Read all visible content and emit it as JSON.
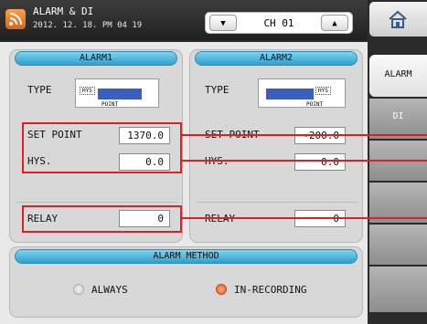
{
  "header": {
    "title": "ALARM & DI",
    "datetime": "2012. 12. 18. PM 04 19",
    "channel": "CH 01",
    "down_arrow": "▼",
    "up_arrow": "▲"
  },
  "nav": {
    "tabs": [
      {
        "label": "ALARM"
      },
      {
        "label": "DI"
      }
    ]
  },
  "alarm1": {
    "title": "ALARM1",
    "type_label": "TYPE",
    "type_icon_text": [
      "HYS",
      "POINT"
    ],
    "set_point_label": "SET POINT",
    "set_point": "1370.0",
    "hys_label": "HYS.",
    "hys": "0.0",
    "relay_label": "RELAY",
    "relay": "0"
  },
  "alarm2": {
    "title": "ALARM2",
    "type_label": "TYPE",
    "type_icon_text": [
      "HYS",
      "POINT"
    ],
    "set_point_label": "SET POINT",
    "set_point": "-200.0",
    "hys_label": "HYS.",
    "hys": "0.0",
    "relay_label": "RELAY",
    "relay": "0"
  },
  "alarm_method": {
    "title": "ALARM METHOD",
    "options": [
      {
        "label": "ALWAYS",
        "selected": false
      },
      {
        "label": "IN-RECORDING",
        "selected": true
      }
    ]
  },
  "colors": {
    "accent": "#2ea0cc",
    "highlight": "#e02020",
    "selected_radio": "#e8542a"
  }
}
